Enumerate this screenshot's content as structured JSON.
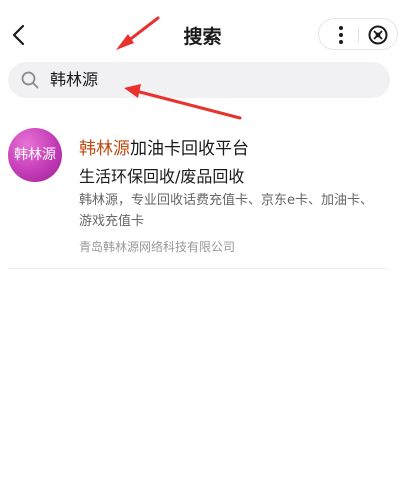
{
  "header": {
    "title": "搜索",
    "back_icon": "chevron-left-icon",
    "more_icon": "more-vertical-icon",
    "close_icon": "close-circle-icon"
  },
  "search": {
    "icon": "search-icon",
    "value": "韩林源"
  },
  "result": {
    "logo_text": "韩林源",
    "title_highlight": "韩林源",
    "title_rest": "加油卡回收平台",
    "subtitle": "生活环保回收/废品回收",
    "description": "韩林源，专业回收话费充值卡、京东e卡、加油卡、游戏充值卡",
    "company": "青岛韩林源网络科技有限公司"
  },
  "colors": {
    "highlight": "#c04a12",
    "logo": "#c43bb7",
    "arrow": "#e8322c",
    "search_bg": "#f1f1f3"
  }
}
